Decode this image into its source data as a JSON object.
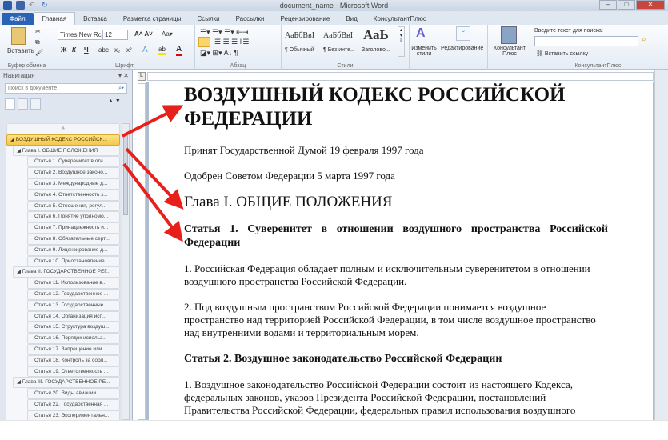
{
  "window": {
    "title": "document_name - Microsoft Word"
  },
  "tabs": [
    "Файл",
    "Главная",
    "Вставка",
    "Разметка страницы",
    "Ссылки",
    "Рассылки",
    "Рецензирование",
    "Вид",
    "КонсультантПлюс"
  ],
  "ribbon": {
    "clipboard": {
      "paste": "Вставить",
      "label": "Буфер обмена"
    },
    "font": {
      "name": "Times New Rc",
      "size": "12",
      "label": "Шрифт",
      "bold": "Ж",
      "italic": "К",
      "underline": "Ч",
      "strike": "abc",
      "sub": "x₂",
      "sup": "x²"
    },
    "paragraph": {
      "label": "Абзац"
    },
    "styles": {
      "label": "Стили",
      "items": [
        {
          "preview": "АаБбВвІ",
          "name": "¶ Обычный"
        },
        {
          "preview": "АаБбВвІ",
          "name": "¶ Без инте..."
        },
        {
          "preview": "АаЬ",
          "name": "Заголово..."
        }
      ],
      "change": "Изменить стили"
    },
    "editing": {
      "label": "Редактирование"
    },
    "consultant": {
      "button": "Консультант Плюс",
      "search_label": "Введите текст для поиска:",
      "insert_link": "Вставить ссылку",
      "label": "КонсультантПлюс"
    }
  },
  "nav": {
    "title": "Навигация",
    "search_placeholder": "Поиск в документе",
    "items": [
      {
        "level": 0,
        "text": "ВОЗДУШНЫЙ КОДЕКС РОССИЙСК..."
      },
      {
        "level": 1,
        "text": "Глава I. ОБЩИЕ ПОЛОЖЕНИЯ"
      },
      {
        "level": 2,
        "text": "Статья 1. Суверенитет в отн..."
      },
      {
        "level": 2,
        "text": "Статья 2. Воздушное законо..."
      },
      {
        "level": 2,
        "text": "Статья 3. Международные д..."
      },
      {
        "level": 2,
        "text": "Статья 4. Ответственность з..."
      },
      {
        "level": 2,
        "text": "Статья 5. Отношения, регул..."
      },
      {
        "level": 2,
        "text": "Статья 6. Понятие уполномо..."
      },
      {
        "level": 2,
        "text": "Статья 7. Принадлежность и..."
      },
      {
        "level": 2,
        "text": "Статья 8. Обязательные серт..."
      },
      {
        "level": 2,
        "text": "Статья 9. Лицензирование д..."
      },
      {
        "level": 2,
        "text": "Статья 10. Приостановление..."
      },
      {
        "level": 1,
        "text": "Глава II. ГОСУДАРСТВЕННОЕ РЕГ..."
      },
      {
        "level": 2,
        "text": "Статья 11. Использование в..."
      },
      {
        "level": 2,
        "text": "Статья 12. Государственное ..."
      },
      {
        "level": 2,
        "text": "Статья 13. Государственные ..."
      },
      {
        "level": 2,
        "text": "Статья 14. Организация исп..."
      },
      {
        "level": 2,
        "text": "Статья 15. Структура воздуш..."
      },
      {
        "level": 2,
        "text": "Статья 16. Порядок использ..."
      },
      {
        "level": 2,
        "text": "Статья 17. Запрещение или ..."
      },
      {
        "level": 2,
        "text": "Статья 18. Контроль за собл..."
      },
      {
        "level": 2,
        "text": "Статья 19. Ответственность ..."
      },
      {
        "level": 1,
        "text": "Глава III. ГОСУДАРСТВЕННОЕ РЕ..."
      },
      {
        "level": 2,
        "text": "Статья 20. Виды авиации"
      },
      {
        "level": 2,
        "text": "Статья 22. Государственная ..."
      },
      {
        "level": 2,
        "text": "Статья 23. Экспериментальн..."
      }
    ]
  },
  "document": {
    "title": "ВОЗДУШНЫЙ КОДЕКС РОССИЙСКОЙ ФЕДЕРАЦИИ",
    "adopted": "Принят Государственной Думой 19 февраля 1997 года",
    "approved": "Одобрен Советом Федерации 5 марта 1997 года",
    "chapter1": "Глава I. ОБЩИЕ ПОЛОЖЕНИЯ",
    "art1": "Статья 1. Суверенитет в отношении воздушного пространства Российской Федерации",
    "art1_p1": "1. Российская Федерация обладает полным и исключительным суверенитетом в отношении воздушного пространства Российской Федерации.",
    "art1_p2": "2. Под воздушным пространством Российской Федерации понимается воздушное пространство над территорией Российской Федерации, в том числе воздушное пространство над внутренними водами и территориальным морем.",
    "art2": "Статья 2. Воздушное законодательство Российской Федерации",
    "art2_p1": "1. Воздушное законодательство Российской Федерации состоит из настоящего Кодекса, федеральных законов, указов Президента Российской Федерации, постановлений Правительства Российской Федерации, федеральных правил использования воздушного"
  },
  "colors": {
    "arrow": "#e8201c",
    "file_tab": "#2a63b5",
    "nav_selected": "#f4c94c"
  }
}
